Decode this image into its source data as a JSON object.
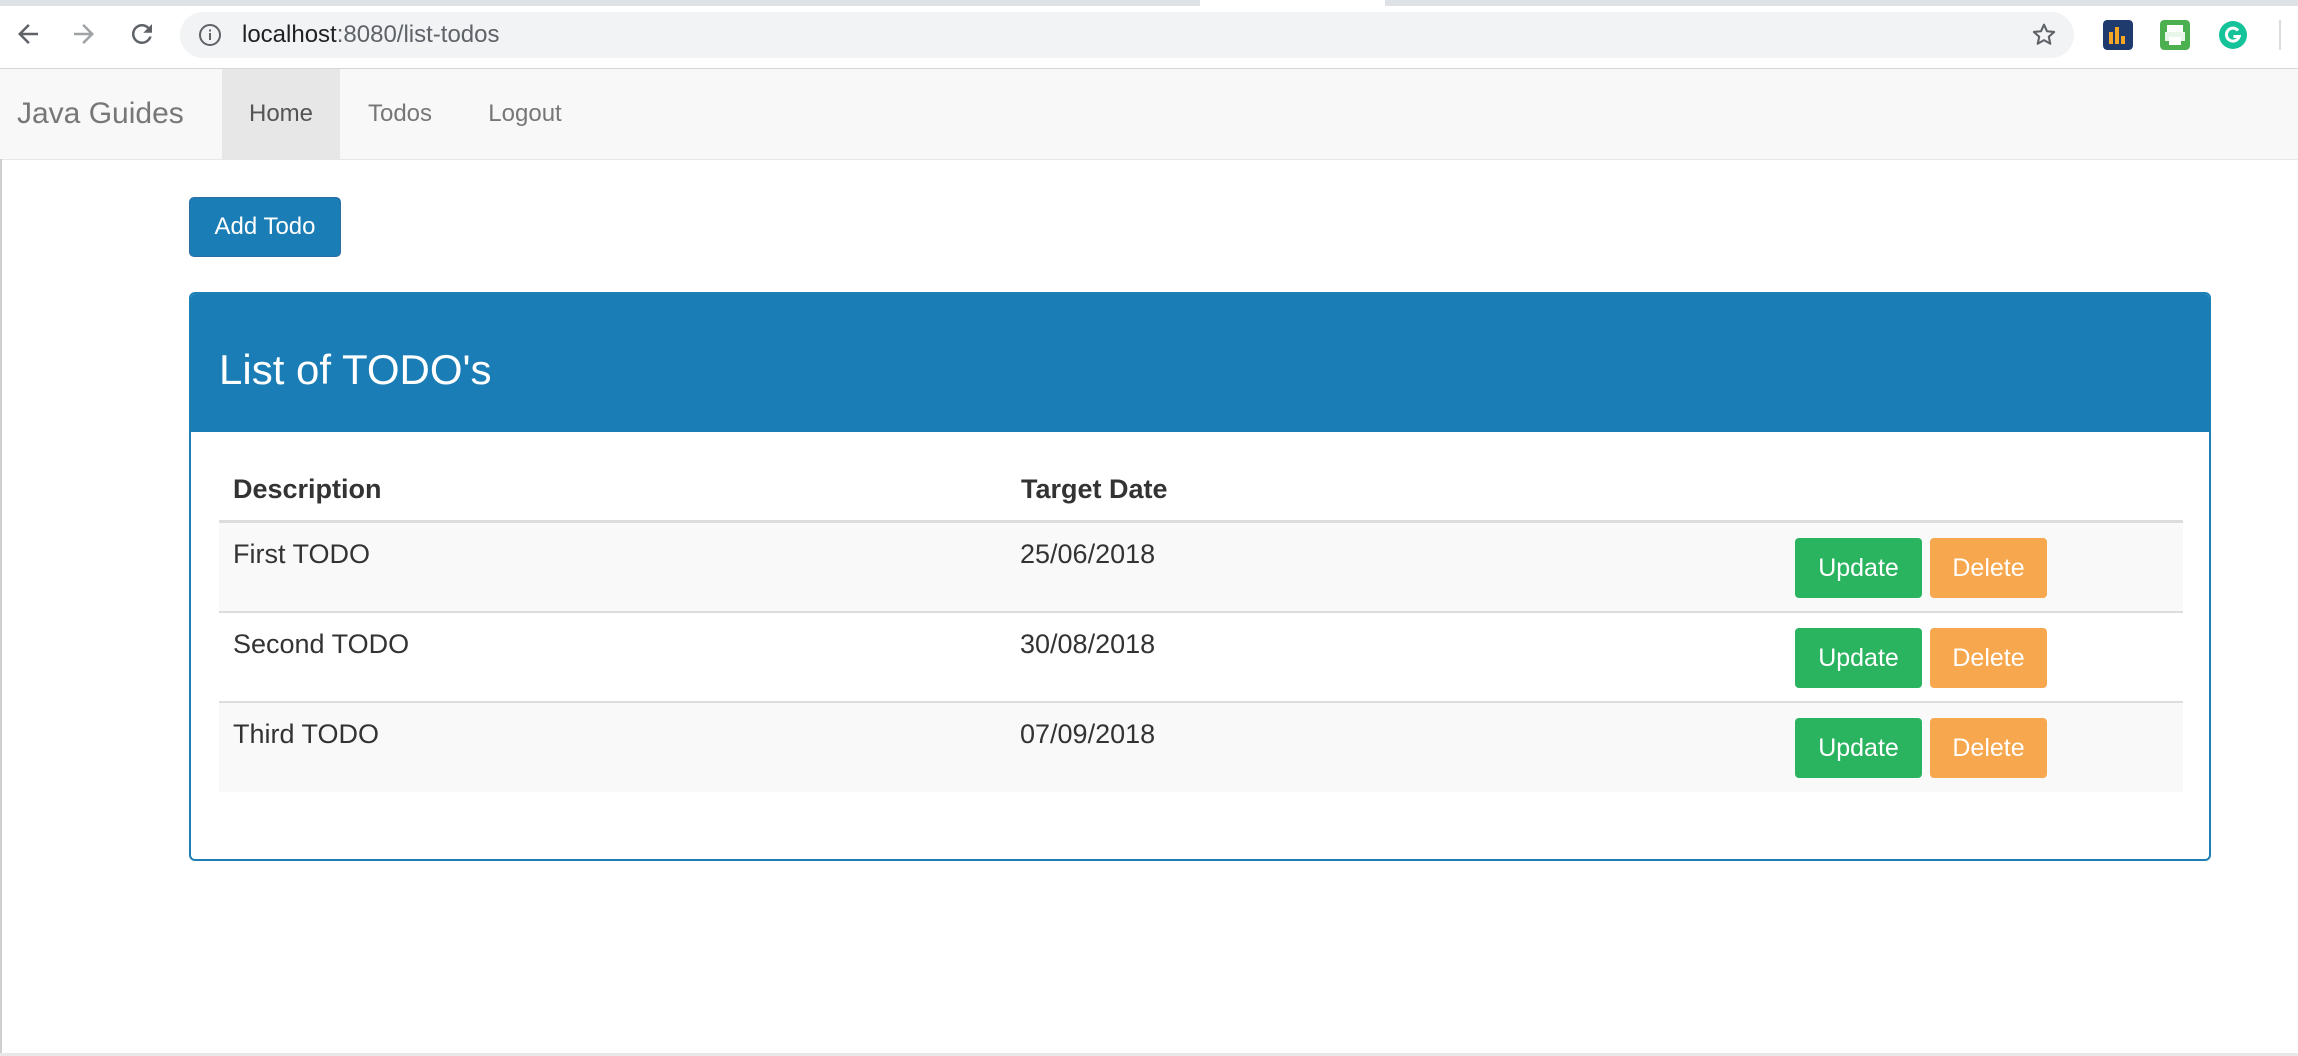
{
  "browser": {
    "url_host": "localhost",
    "url_rest": ":8080/list-todos",
    "icons": {
      "back": "arrow-left-icon",
      "forward": "arrow-right-icon",
      "reload": "reload-icon",
      "info": "info-icon",
      "bookmark": "star-icon",
      "extensions": [
        "chart-extension-icon",
        "print-extension-icon",
        "grammarly-extension-icon"
      ]
    }
  },
  "navbar": {
    "brand": "Java Guides",
    "items": [
      {
        "label": "Home",
        "active": true
      },
      {
        "label": "Todos",
        "active": false
      },
      {
        "label": "Logout",
        "active": false
      }
    ]
  },
  "main": {
    "add_button_label": "Add Todo",
    "panel_title": "List of TODO's",
    "table": {
      "headers": [
        "Description",
        "Target Date"
      ],
      "rows": [
        {
          "description": "First TODO",
          "target_date": "25/06/2018",
          "update_label": "Update",
          "delete_label": "Delete"
        },
        {
          "description": "Second TODO",
          "target_date": "30/08/2018",
          "update_label": "Update",
          "delete_label": "Delete"
        },
        {
          "description": "Third TODO",
          "target_date": "07/09/2018",
          "update_label": "Update",
          "delete_label": "Delete"
        }
      ]
    }
  },
  "colors": {
    "primary": "#1a7db6",
    "success": "#2ab460",
    "warning": "#f7a74d",
    "navbar_bg": "#f8f8f8"
  }
}
